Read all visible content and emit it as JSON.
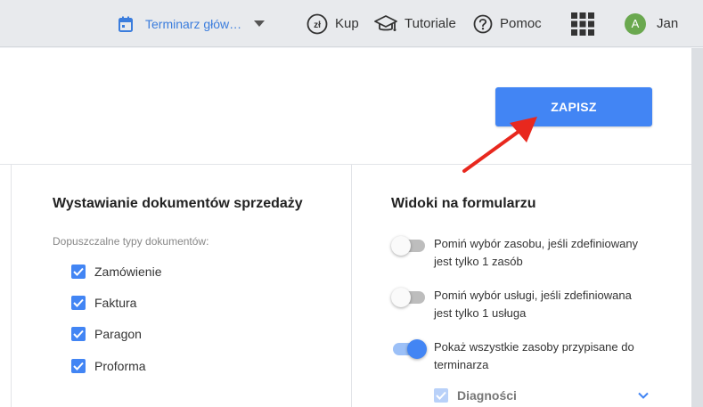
{
  "topbar": {
    "calendar_label": "Terminarz głów…",
    "buy_label": "Kup",
    "buy_icon_text": "zł",
    "tutorials_label": "Tutoriale",
    "help_label": "Pomoc",
    "user_initial": "A",
    "user_name": "Jan"
  },
  "toolbar": {
    "save_label": "ZAPISZ"
  },
  "sales_docs": {
    "title": "Wystawianie dokumentów sprzedaży",
    "allowed_label": "Dopuszczalne typy dokumentów:",
    "items": [
      {
        "label": "Zamówienie",
        "checked": true
      },
      {
        "label": "Faktura",
        "checked": true
      },
      {
        "label": "Paragon",
        "checked": true
      },
      {
        "label": "Proforma",
        "checked": true
      }
    ]
  },
  "form_views": {
    "title": "Widoki na formularzu",
    "toggles": [
      {
        "label": "Pomiń wybór zasobu, jeśli zdefiniowany jest tylko 1 zasób",
        "on": false
      },
      {
        "label": "Pomiń wybór usługi, jeśli zdefiniowana jest tylko 1 usługa",
        "on": false
      },
      {
        "label": "Pokaż wszystkie zasoby przypisane do terminarza",
        "on": true
      }
    ],
    "sub_item": {
      "label": "Diagności",
      "checked": true
    }
  },
  "colors": {
    "accent": "#4285f4",
    "annotation_arrow": "#e8281e"
  }
}
